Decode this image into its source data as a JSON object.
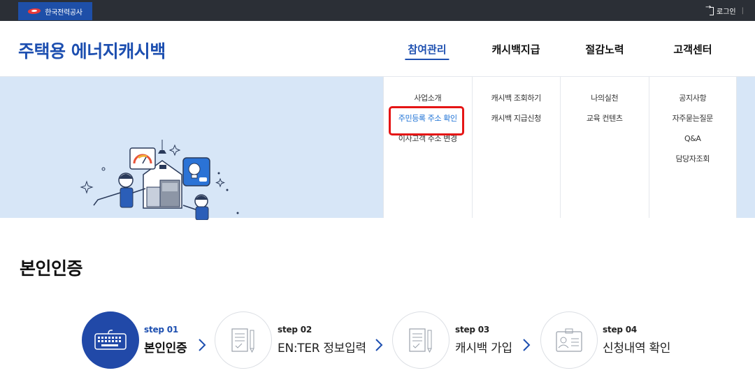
{
  "topbar": {
    "org_name": "한국전력공사",
    "login_label": "로그인",
    "separator": "|"
  },
  "header": {
    "brand": "주택용 에너지캐시백",
    "nav": [
      {
        "label": "참여관리",
        "active": true
      },
      {
        "label": "캐시백지급",
        "active": false
      },
      {
        "label": "절감노력",
        "active": false
      },
      {
        "label": "고객센터",
        "active": false
      }
    ]
  },
  "mega_menu": {
    "columns": [
      [
        "사업소개",
        "주민등록 주소 확인",
        "이사고객 주소 변경"
      ],
      [
        "캐시백 조회하기",
        "캐시백 지급신청"
      ],
      [
        "나의실천",
        "교육 컨텐츠"
      ],
      [
        "공지사항",
        "자주묻는질문",
        "Q&A",
        "담당자조회"
      ]
    ],
    "highlighted": "주민등록 주소 확인"
  },
  "page": {
    "title": "본인인증"
  },
  "steps": [
    {
      "num": "step 01",
      "label": "본인인증",
      "icon": "keyboard-icon",
      "active": true
    },
    {
      "num": "step 02",
      "label": "EN:TER 정보입력",
      "icon": "document-pencil-icon",
      "active": false
    },
    {
      "num": "step 03",
      "label": "캐시백 가입",
      "icon": "document-pencil-icon",
      "active": false
    },
    {
      "num": "step 04",
      "label": "신청내역 확인",
      "icon": "id-card-icon",
      "active": false
    }
  ],
  "colors": {
    "brand_blue": "#1d4fb0",
    "topbar": "#2b2f36",
    "hero_bg": "#d7e6f7",
    "highlight_border": "#e51515"
  }
}
